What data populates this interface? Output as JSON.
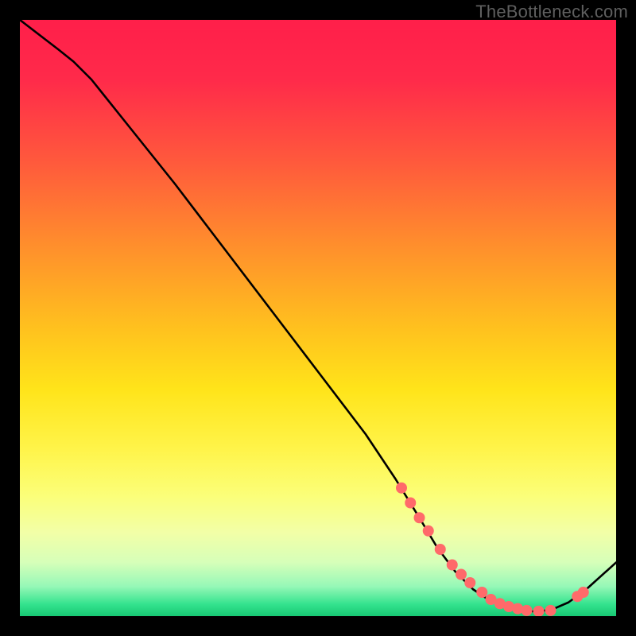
{
  "watermark": "TheBottleneck.com",
  "chart_data": {
    "type": "line",
    "title": "",
    "xlabel": "",
    "ylabel": "",
    "xlim": [
      0,
      100
    ],
    "ylim": [
      0,
      100
    ],
    "grid": false,
    "background_gradient": {
      "top": "#ff1f4a",
      "mid": "#ffe41a",
      "bottom": "#17c873"
    },
    "series": [
      {
        "name": "bottleneck-curve",
        "color": "#000000",
        "x": [
          0,
          6.5,
          9,
          12,
          18,
          26,
          34,
          42,
          50,
          58,
          63,
          67,
          70,
          73,
          76,
          79,
          83,
          86,
          89,
          92,
          95,
          100
        ],
        "y": [
          100,
          95,
          93,
          90,
          82.5,
          72.5,
          62,
          51.5,
          41,
          30.5,
          23,
          16.5,
          11.5,
          7.5,
          4.5,
          2.5,
          1.2,
          0.8,
          1,
          2.3,
          4.5,
          9
        ]
      }
    ],
    "highlight_points": {
      "name": "curve-dots",
      "color": "#ff6a6a",
      "x": [
        64,
        65.5,
        67,
        68.5,
        70.5,
        72.5,
        74,
        75.5,
        77.5,
        79,
        80.5,
        82,
        83.5,
        85,
        87,
        89,
        93.5,
        94.5
      ],
      "y": [
        21.5,
        19,
        16.5,
        14.3,
        11.2,
        8.6,
        7,
        5.6,
        4,
        2.8,
        2.1,
        1.6,
        1.25,
        0.95,
        0.82,
        0.95,
        3.3,
        4.0
      ]
    }
  }
}
